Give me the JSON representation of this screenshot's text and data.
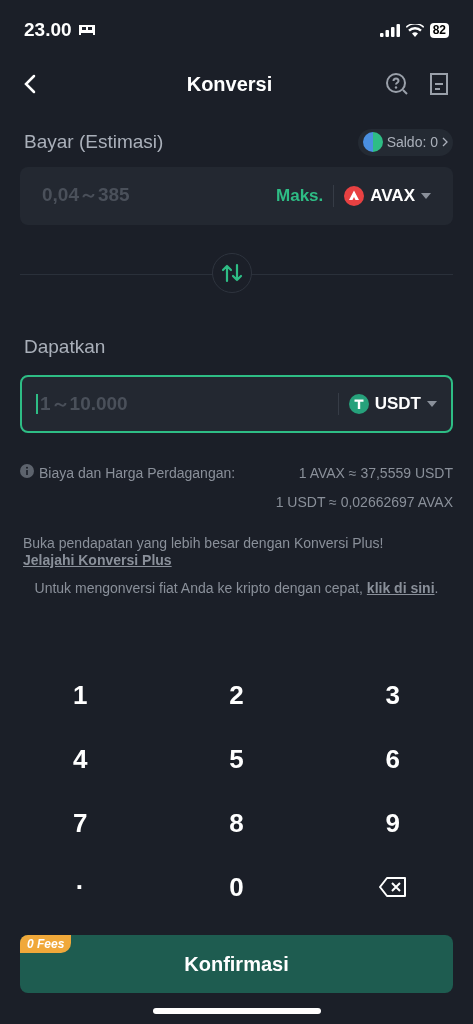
{
  "status_bar": {
    "time": "23.00",
    "battery": "82"
  },
  "header": {
    "title": "Konversi"
  },
  "pay": {
    "label": "Bayar (Estimasi)",
    "balance": "Saldo: 0",
    "placeholder": "0,04～385",
    "max": "Maks.",
    "currency": "AVAX",
    "focused": false
  },
  "receive": {
    "label": "Dapatkan",
    "placeholder": "1～10.000",
    "currency": "USDT",
    "focused": true
  },
  "rates": {
    "label": "Biaya dan Harga Perdagangan:",
    "lines": [
      "1 AVAX ≈ 37,5559 USDT",
      "1 USDT ≈ 0,02662697 AVAX"
    ]
  },
  "promo": {
    "text": "Buka pendapatan yang lebih besar dengan Konversi Plus!",
    "link": "Jelajahi Konversi Plus"
  },
  "fiat": {
    "text": "Untuk mengonversi fiat Anda ke kripto dengan cepat,",
    "link": "klik di sini",
    "end": "."
  },
  "keypad": [
    {
      "kind": "digit",
      "label": "1"
    },
    {
      "kind": "digit",
      "label": "2"
    },
    {
      "kind": "digit",
      "label": "3"
    },
    {
      "kind": "digit",
      "label": "4"
    },
    {
      "kind": "digit",
      "label": "5"
    },
    {
      "kind": "digit",
      "label": "6"
    },
    {
      "kind": "digit",
      "label": "7"
    },
    {
      "kind": "digit",
      "label": "8"
    },
    {
      "kind": "digit",
      "label": "9"
    },
    {
      "kind": "digit",
      "label": "·"
    },
    {
      "kind": "digit",
      "label": "0"
    },
    {
      "kind": "backspace"
    }
  ],
  "confirm": {
    "label": "Konfirmasi",
    "badge": "0 Fees"
  }
}
